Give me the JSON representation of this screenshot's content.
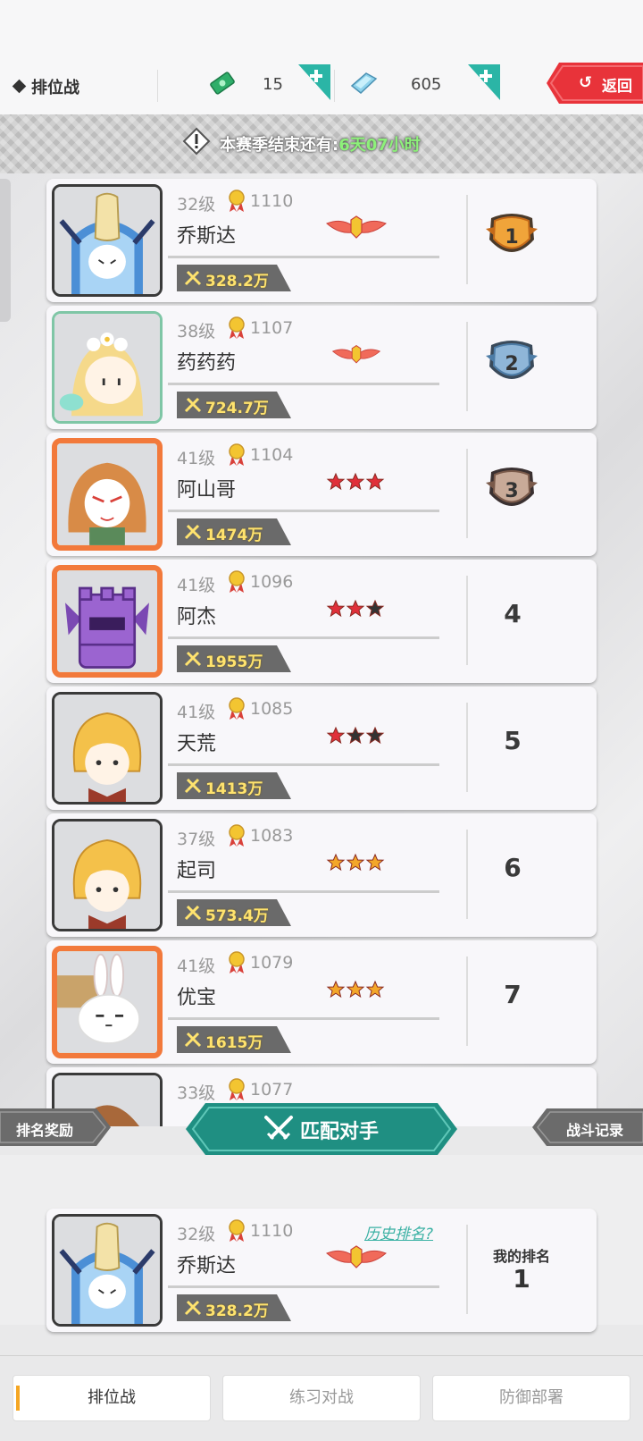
{
  "header": {
    "title": "排位战",
    "tickets": "15",
    "gems": "605",
    "back_label": "返回"
  },
  "season": {
    "label": "本赛季结束还有:",
    "remaining": "6天07小时"
  },
  "colors": {
    "accent_teal": "#1f8f82",
    "back_red": "#e8333a",
    "power_gold": "#ffe36e"
  },
  "players": [
    {
      "level": "32级",
      "score": "1110",
      "name": "乔斯达",
      "power": "328.2万",
      "badge": "wings-gold",
      "rank": "1",
      "rank_display": "shield-gold",
      "frame": "dark",
      "avatar": "knight-icon"
    },
    {
      "level": "38级",
      "score": "1107",
      "name": "药药药",
      "power": "724.7万",
      "badge": "wings-small",
      "rank": "2",
      "rank_display": "shield-silver",
      "frame": "green",
      "avatar": "flower-girl-icon"
    },
    {
      "level": "41级",
      "score": "1104",
      "name": "阿山哥",
      "power": "1474万",
      "badge": "stars-3-red",
      "rank": "3",
      "rank_display": "shield-bronze",
      "frame": "orange",
      "avatar": "masked-girl-icon"
    },
    {
      "level": "41级",
      "score": "1096",
      "name": "阿杰",
      "power": "1955万",
      "badge": "stars-2-red",
      "rank": "4",
      "rank_display": "number",
      "frame": "orange",
      "avatar": "tower-golem-icon"
    },
    {
      "level": "41级",
      "score": "1085",
      "name": "天荒",
      "power": "1413万",
      "badge": "stars-1-red",
      "rank": "5",
      "rank_display": "number",
      "frame": "dark",
      "avatar": "blond-boy-icon"
    },
    {
      "level": "37级",
      "score": "1083",
      "name": "起司",
      "power": "573.4万",
      "badge": "stars-3-gold",
      "rank": "6",
      "rank_display": "number",
      "frame": "dark",
      "avatar": "blond-boy-icon"
    },
    {
      "level": "41级",
      "score": "1079",
      "name": "优宝",
      "power": "1615万",
      "badge": "stars-3-gold",
      "rank": "7",
      "rank_display": "number",
      "frame": "orange",
      "avatar": "bunny-icon"
    },
    {
      "level": "33级",
      "score": "1077",
      "name": "",
      "power": "",
      "badge": "",
      "rank": "",
      "rank_display": "number",
      "frame": "dark",
      "avatar": "brown-hair-icon"
    }
  ],
  "actions": {
    "reward_label": "排名奖励",
    "match_label": "匹配对手",
    "record_label": "战斗记录"
  },
  "me": {
    "level": "32级",
    "score": "1110",
    "name": "乔斯达",
    "power": "328.2万",
    "history_link": "历史排名?",
    "my_rank_label": "我的排名",
    "my_rank": "1"
  },
  "tabs": [
    {
      "label": "排位战",
      "active": true
    },
    {
      "label": "练习对战",
      "active": false
    },
    {
      "label": "防御部署",
      "active": false
    }
  ]
}
